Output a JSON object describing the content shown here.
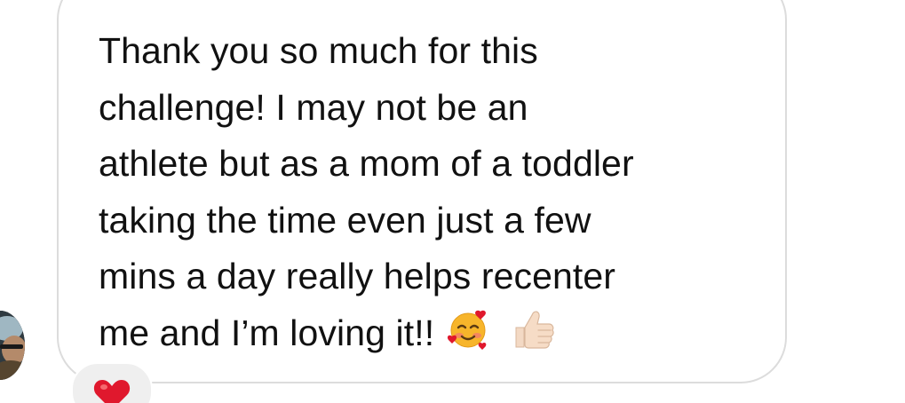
{
  "message": {
    "lines": [
      "Thank you so much for this",
      "challenge! I may not be an",
      "athlete but as a mom of a toddler",
      "taking the time even just a few",
      "mins a day really helps recenter",
      "me and I’m loving it!!"
    ],
    "emojis": [
      "smiling-face-with-hearts-emoji",
      "thumbs-up-emoji"
    ]
  },
  "reaction": {
    "icon": "red-heart-icon"
  },
  "colors": {
    "bubble_border": "#dcdcdc",
    "text": "#111111",
    "reaction_bg": "#efefef",
    "heart": "#e0182d"
  }
}
